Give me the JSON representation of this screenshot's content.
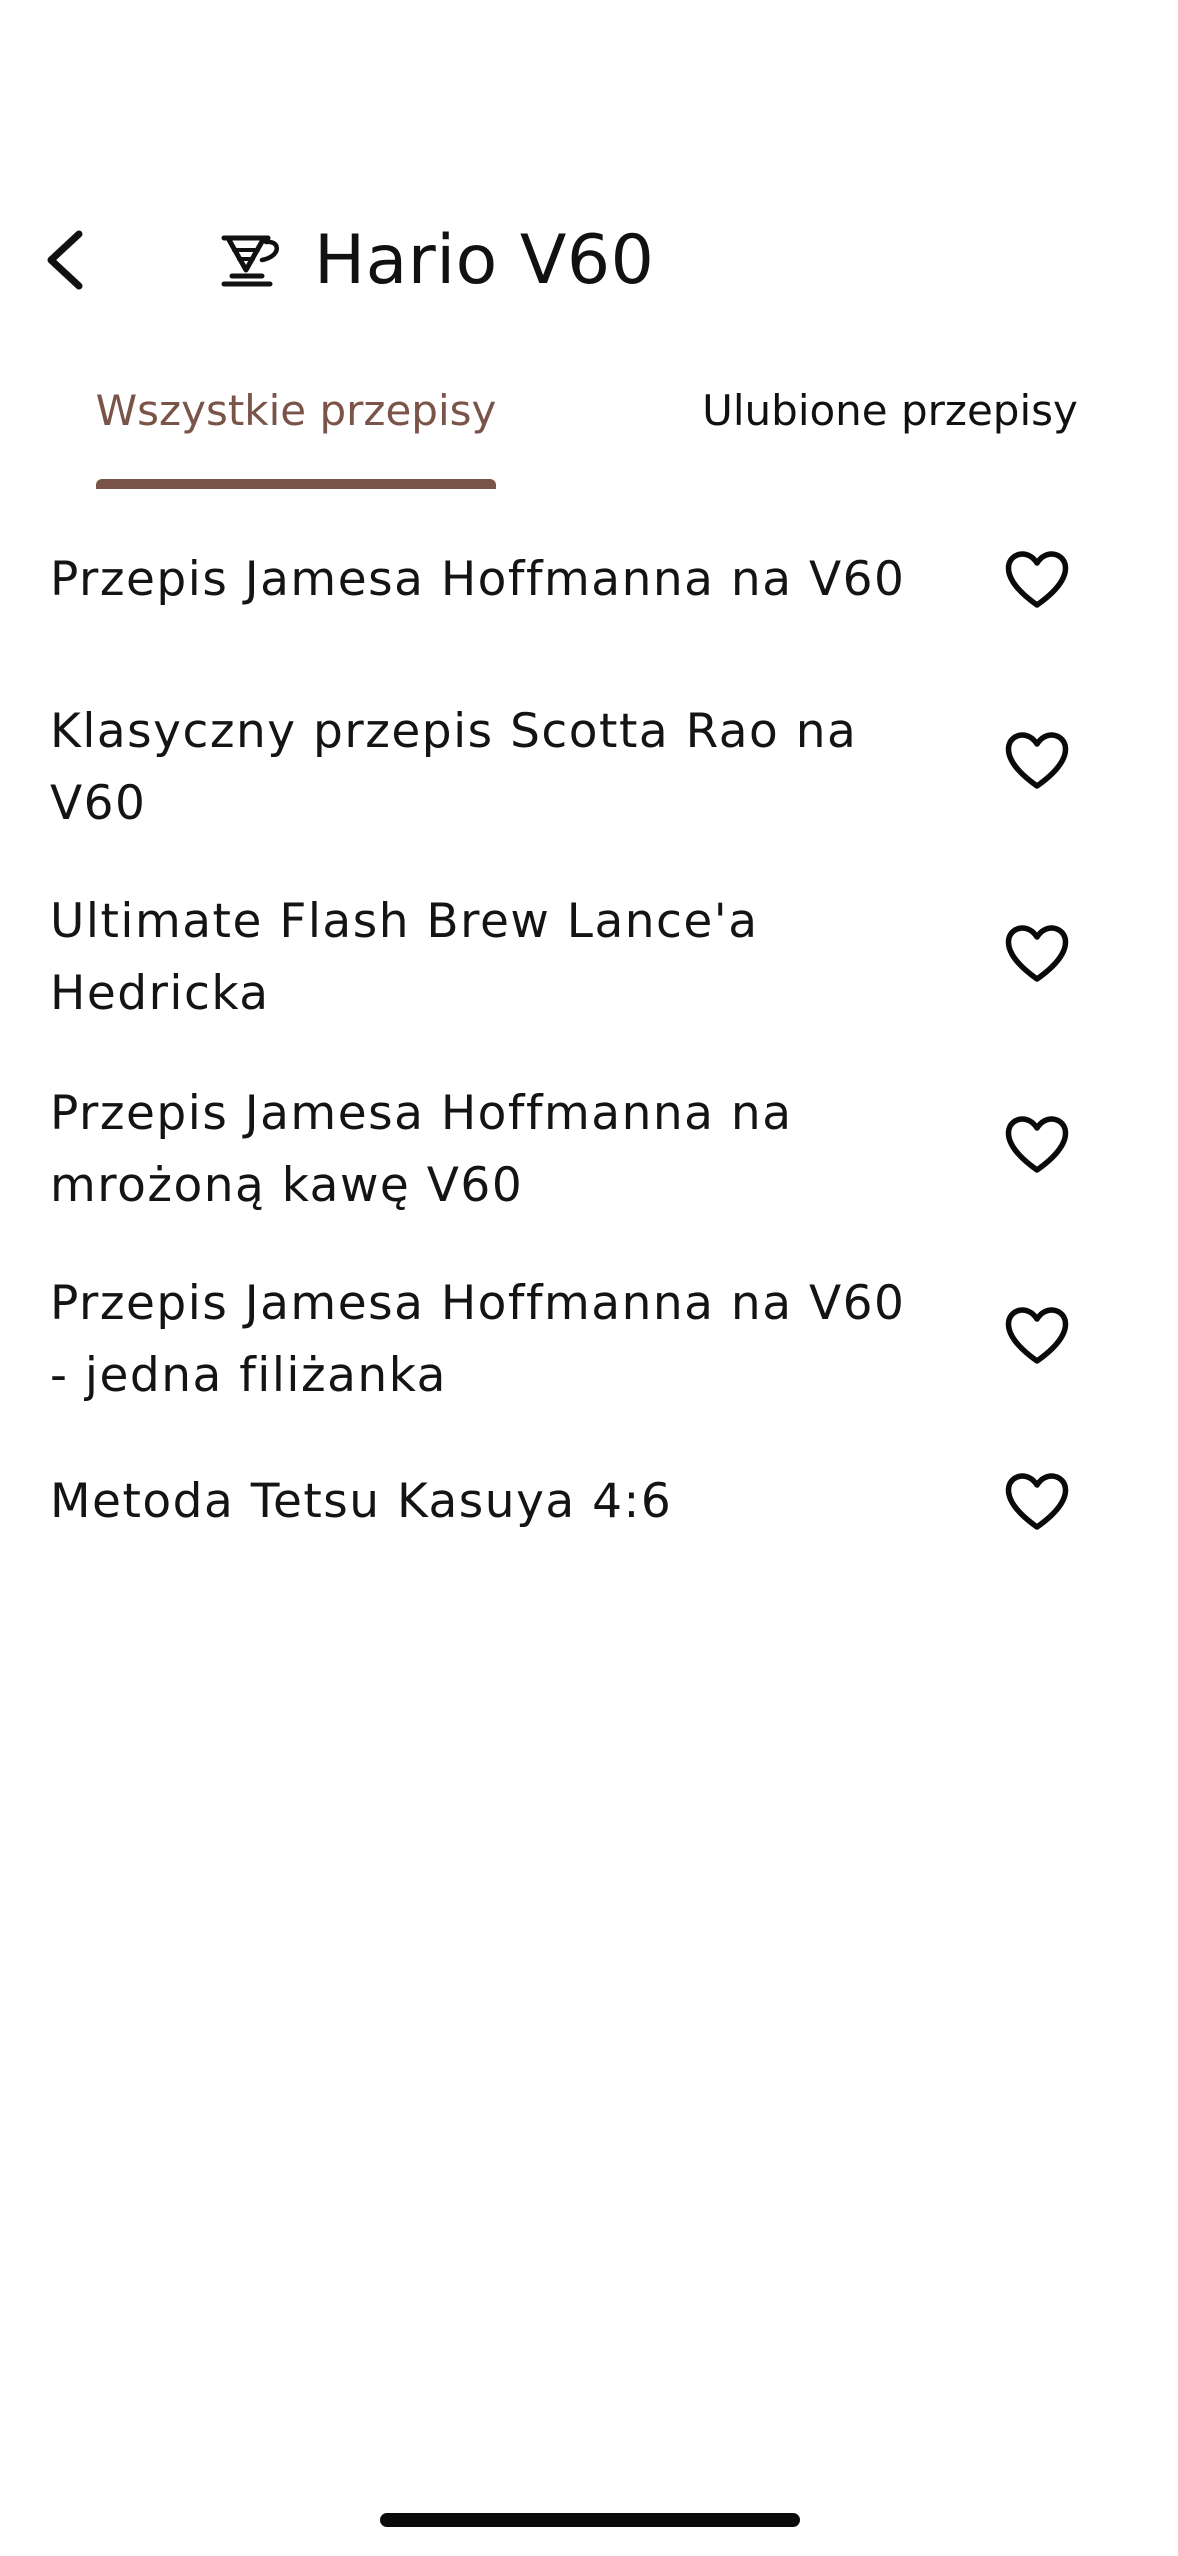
{
  "header": {
    "title": "Hario V60",
    "back_icon": "chevron-left-icon",
    "title_icon": "dripper-icon"
  },
  "tabs": [
    {
      "label": "Wszystkie przepisy",
      "active": true
    },
    {
      "label": "Ulubione przepisy",
      "active": false
    }
  ],
  "recipes": [
    {
      "line1": "Przepis Jamesa Hoffmanna na V60",
      "line2": "",
      "favorite": false
    },
    {
      "line1": "Klasyczny przepis Scotta Rao na",
      "line2": "V60",
      "favorite": false
    },
    {
      "line1": "Ultimate Flash Brew Lance'a",
      "line2": "Hedricka",
      "favorite": false
    },
    {
      "line1": "Przepis Jamesa Hoffmanna na",
      "line2": "mrożoną kawę V60",
      "favorite": false
    },
    {
      "line1": "Przepis Jamesa Hoffmanna na V60",
      "line2": "- jedna filiżanka",
      "favorite": false
    },
    {
      "line1": "Metoda Tetsu Kasuya 4:6",
      "line2": "",
      "favorite": false
    }
  ],
  "colors": {
    "accent": "#7a5449",
    "text": "#141414",
    "background": "#ffffff"
  }
}
